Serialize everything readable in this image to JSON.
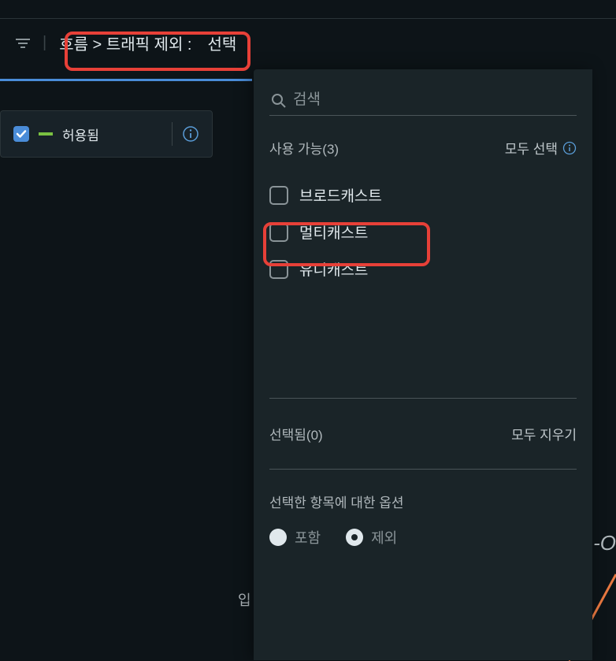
{
  "breadcrumb": {
    "path": "흐름 > 트래픽 제외 :",
    "selection": "선택"
  },
  "filterTag": {
    "label": "허용됨"
  },
  "dropdown": {
    "search": {
      "placeholder": "검색"
    },
    "available": {
      "title": "사용 가능(3)",
      "selectAll": "모두 선택",
      "items": [
        {
          "label": "브로드캐스트"
        },
        {
          "label": "멀티캐스트"
        },
        {
          "label": "유니캐스트"
        }
      ]
    },
    "selected": {
      "title": "선택됨(0)",
      "clearAll": "모두 지우기"
    },
    "options": {
      "title": "선택한 항목에 대한 옵션",
      "include": "포함",
      "exclude": "제외",
      "selected": "exclude"
    }
  },
  "bgText": "L-O",
  "bgPartial": "입"
}
